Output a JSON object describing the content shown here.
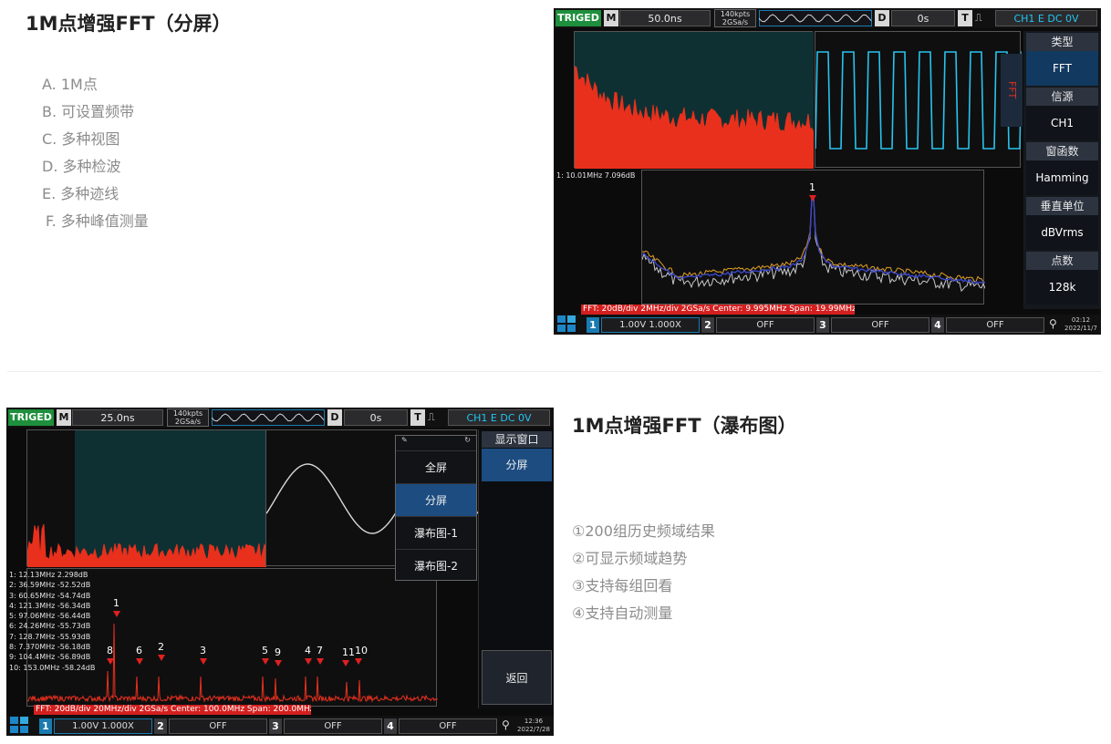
{
  "section1": {
    "title": "1M点增强FFT（分屏）",
    "features": [
      "A. 1M点",
      "B. 可设置频带",
      "C. 多种视图",
      "D. 多种检波",
      "E. 多种迹线",
      "F. 多种峰值测量"
    ]
  },
  "section2": {
    "title": "1M点增强FFT（瀑布图）",
    "features": [
      "①200组历史频域结果",
      "②可显示频域趋势",
      "③支持每组回看",
      "④支持自动测量"
    ]
  },
  "scope1": {
    "trig_status": "TRIGED",
    "mode_letter": "M",
    "timebase": "50.0ns",
    "mem_depth": "140kpts",
    "sample_rate": "2GSa/s",
    "delay_letter": "D",
    "delay": "0s",
    "trig_letter": "T",
    "trig_info": "CH1 E DC 0V",
    "fft_tag": "FFT",
    "marker_label": "1",
    "readout": "1: 10.01MHz 7.096dB",
    "status_line": "FFT: 20dB/div 2MHz/div 2GSa/s Center: 9.995MHz Span: 19.99MHz",
    "menu": [
      {
        "label": "类型",
        "value": "FFT"
      },
      {
        "label": "信源",
        "value": "CH1"
      },
      {
        "label": "窗函数",
        "value": "Hamming"
      },
      {
        "label": "垂直单位",
        "value": "dBVrms"
      },
      {
        "label": "点数",
        "value": "128k"
      }
    ],
    "channels": {
      "ch1_num": "1",
      "ch1_text": "1.00V 1.000X",
      "ch2_num": "2",
      "ch2_text": "OFF",
      "ch3_num": "3",
      "ch3_text": "OFF",
      "ch4_num": "4",
      "ch4_text": "OFF"
    },
    "time": "02:12",
    "date": "2022/11/7"
  },
  "scope2": {
    "trig_status": "TRIGED",
    "mode_letter": "M",
    "timebase": "25.0ns",
    "mem_depth": "140kpts",
    "sample_rate": "2GSa/s",
    "delay_letter": "D",
    "delay": "0s",
    "trig_letter": "T",
    "trig_info": "CH1 E DC 0V",
    "readouts": [
      "1: 12.13MHz 2.298dB",
      "2: 36.59MHz -52.52dB",
      "3: 60.65MHz -54.74dB",
      "4: 121.3MHz -56.34dB",
      "5: 97.06MHz -56.44dB",
      "6: 24.26MHz -55.73dB",
      "7: 128.7MHz -55.93dB",
      "8: 7.370MHz -56.18dB",
      "9: 104.4MHz -56.89dB",
      "10: 153.0MHz -58.24dB"
    ],
    "peak_labels": [
      "1",
      "8",
      "6",
      "2",
      "3",
      "5",
      "9",
      "4",
      "7",
      "11",
      "10"
    ],
    "status_line": "FFT: 20dB/div 20MHz/div 2GSa/s Center: 100.0MHz Span: 200.0MHz",
    "display_window_label": "显示窗口",
    "display_window_value": "分屏",
    "popup_items": [
      "全屏",
      "分屏",
      "瀑布图-1",
      "瀑布图-2"
    ],
    "back_label": "返回",
    "channels": {
      "ch1_num": "1",
      "ch1_text": "1.00V 1.000X",
      "ch2_num": "2",
      "ch2_text": "OFF",
      "ch3_num": "3",
      "ch3_text": "OFF",
      "ch4_num": "4",
      "ch4_text": "OFF"
    },
    "time": "12:36",
    "date": "2022/7/28"
  },
  "colors": {
    "trig_green": "#1e8f3c",
    "fft_red": "#e8301c",
    "wave_cyan": "#27c4ee",
    "menu_blue": "#1c4c80",
    "spectrum_blue": "#3a46c8"
  }
}
